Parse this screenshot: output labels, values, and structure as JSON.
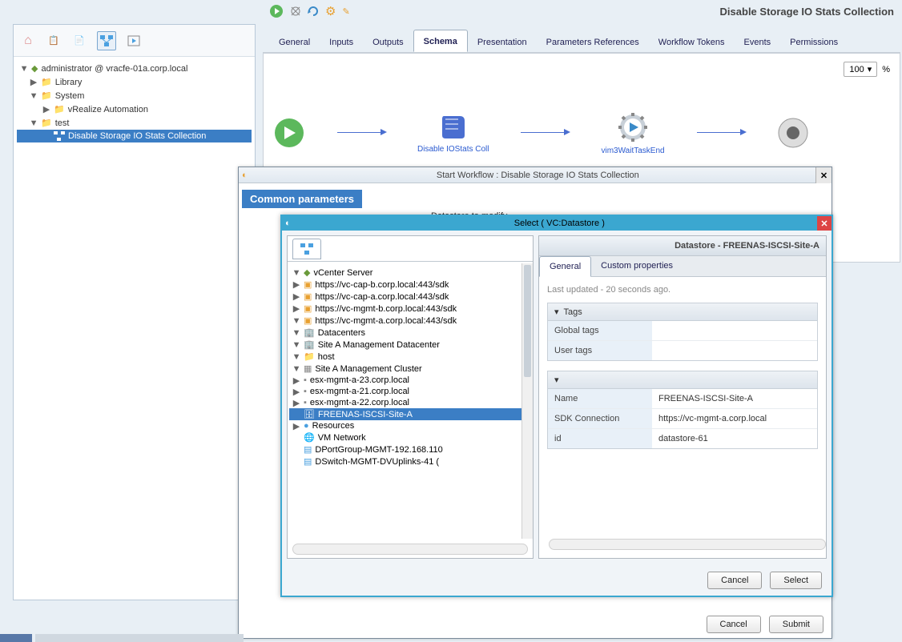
{
  "header_title": "Disable Storage IO Stats Collection",
  "left_tree": {
    "root": "administrator @ vracfe-01a.corp.local",
    "library": "Library",
    "system": "System",
    "vra": "vRealize Automation",
    "test": "test",
    "leaf": "Disable Storage IO Stats Collection"
  },
  "tabs": {
    "general": "General",
    "inputs": "Inputs",
    "outputs": "Outputs",
    "schema": "Schema",
    "presentation": "Presentation",
    "paramrefs": "Parameters References",
    "wftokens": "Workflow Tokens",
    "events": "Events",
    "permissions": "Permissions"
  },
  "zoom": {
    "value": "100",
    "pct": "%"
  },
  "flow": {
    "node2": "Disable IOStats Coll",
    "node3": "vim3WaitTaskEnd"
  },
  "workflow_dlg": {
    "title": "Start Workflow : Disable Storage IO Stats Collection",
    "section": "Common parameters",
    "field_label": "Datastore to modify",
    "cancel": "Cancel",
    "submit": "Submit"
  },
  "select_dlg": {
    "title": "Select ( VC:Datastore  )",
    "right_hdr": "Datastore - FREENAS-ISCSI-Site-A",
    "tab_general": "General",
    "tab_custom": "Custom properties",
    "last_updated": "Last updated - 20 seconds ago.",
    "tags_hdr": "Tags",
    "tags": {
      "global": "Global tags",
      "user": "User tags"
    },
    "props": {
      "name_k": "Name",
      "name_v": "FREENAS-ISCSI-Site-A",
      "sdk_k": "SDK Connection",
      "sdk_v": "https://vc-mgmt-a.corp.local",
      "id_k": "id",
      "id_v": "datastore-61"
    },
    "cancel": "Cancel",
    "select": "Select",
    "tree": {
      "root": "vCenter Server",
      "s1": "https://vc-cap-b.corp.local:443/sdk",
      "s2": "https://vc-cap-a.corp.local:443/sdk",
      "s3": "https://vc-mgmt-b.corp.local:443/sdk",
      "s4": "https://vc-mgmt-a.corp.local:443/sdk",
      "dc": "Datacenters",
      "dc1": "Site A Management Datacenter",
      "host": "host",
      "cluster": "Site A Management Cluster",
      "esx1": "esx-mgmt-a-23.corp.local",
      "esx2": "esx-mgmt-a-21.corp.local",
      "esx3": "esx-mgmt-a-22.corp.local",
      "ds": "FREENAS-ISCSI-Site-A",
      "res": "Resources",
      "vmn": "VM Network",
      "dpg": "DPortGroup-MGMT-192.168.110",
      "dsw": "DSwitch-MGMT-DVUplinks-41 ("
    }
  }
}
